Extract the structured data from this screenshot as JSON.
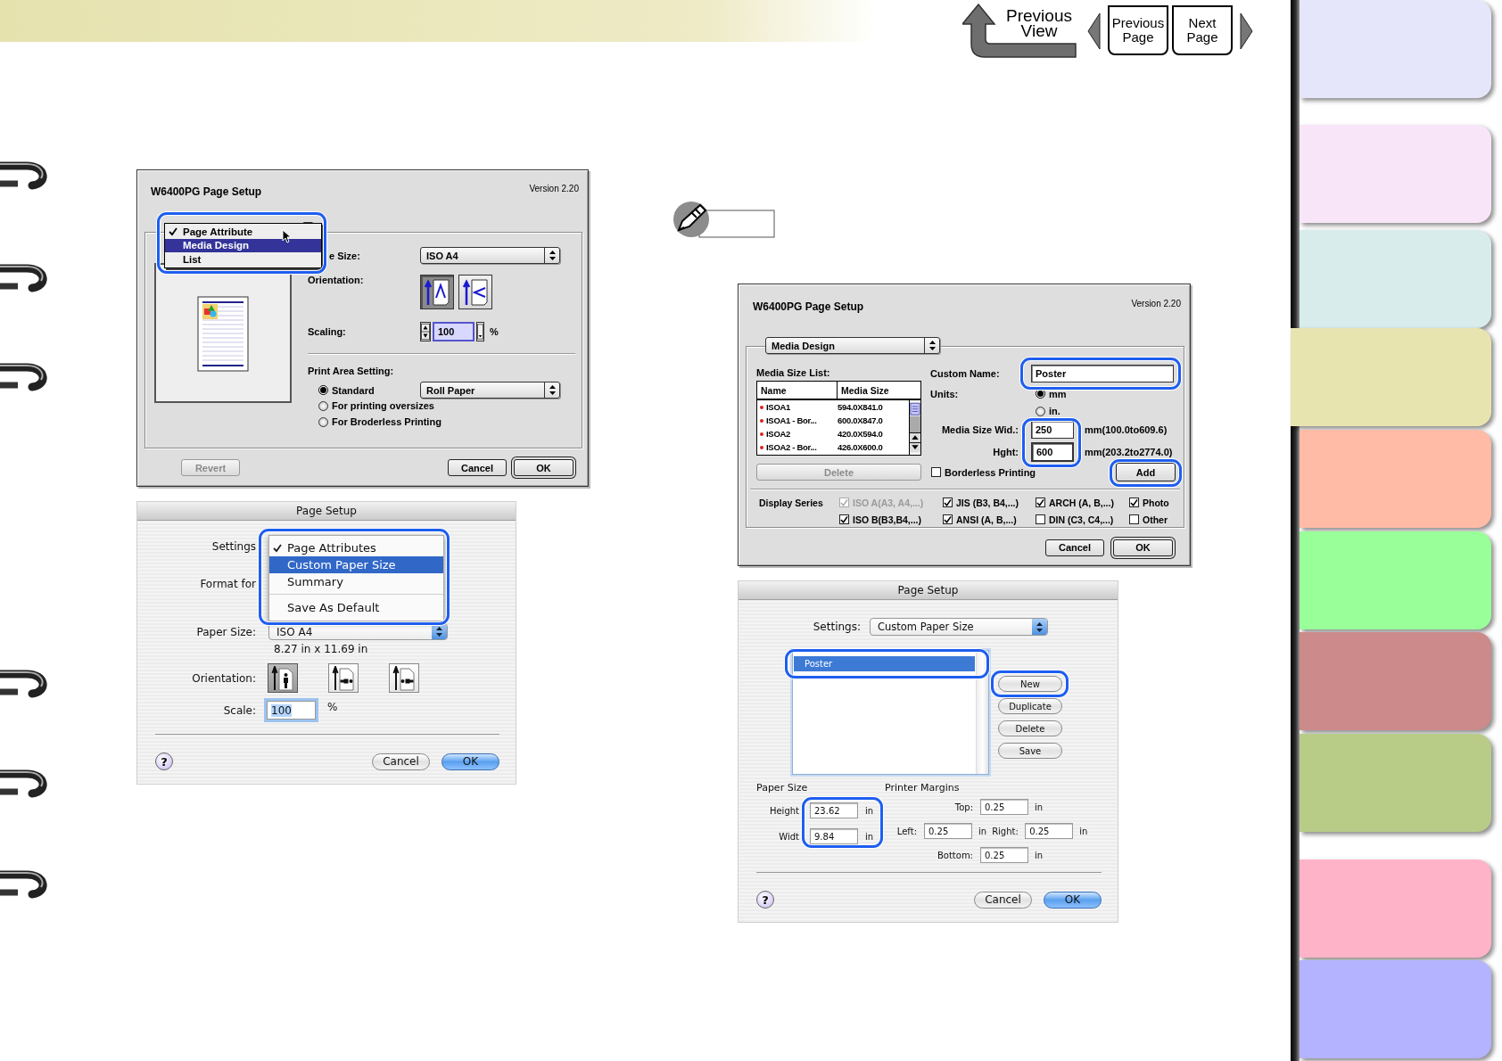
{
  "top_nav": {
    "previous_view": "Previous View",
    "previous_page": "Previous Page",
    "next_page": "Next Page"
  },
  "side_tabs": [
    {
      "color": "#e6e6fa",
      "selected": false
    },
    {
      "color": "#f8e6f8",
      "selected": false
    },
    {
      "color": "#d8ecec",
      "selected": false
    },
    {
      "color": "#e8e4b0",
      "selected": true
    },
    {
      "color": "#ffbba6",
      "selected": false
    },
    {
      "color": "#99ff99",
      "selected": false
    },
    {
      "color": "#cc8a8a",
      "selected": false
    },
    {
      "color": "#b8cc88",
      "selected": false
    },
    {
      "color": "#ffb3c8",
      "selected": false
    },
    {
      "color": "#b3b3ff",
      "selected": false
    }
  ],
  "page_setup_classic": {
    "title": "W6400PG Page Setup",
    "version": "Version 2.20",
    "panel_menu": {
      "highlighted": true,
      "items": [
        {
          "label": "Page Attribute",
          "checked": true,
          "selected": false
        },
        {
          "label": "Media Design",
          "checked": false,
          "selected": true
        },
        {
          "label": "List",
          "checked": false,
          "selected": false
        }
      ]
    },
    "paper_size": {
      "label": "e Size:",
      "value": "ISO A4"
    },
    "orientation": {
      "label": "Orientation:",
      "options": [
        {
          "selected": true
        },
        {
          "selected": false
        }
      ]
    },
    "scaling": {
      "label": "Scaling:",
      "value": "100",
      "unit": "%"
    },
    "print_area": {
      "label": "Print Area Setting:",
      "paper_source": "Roll Paper",
      "options": [
        {
          "label": "Standard",
          "selected": true
        },
        {
          "label": "For printing oversizes",
          "selected": false
        },
        {
          "label": "For Broderless Printing",
          "selected": false
        }
      ]
    },
    "buttons": [
      {
        "label": "Revert",
        "disabled": true,
        "default": false
      },
      {
        "label": "Cancel",
        "disabled": false,
        "default": false
      },
      {
        "label": "OK",
        "disabled": false,
        "default": true
      }
    ]
  },
  "page_setup_aqua": {
    "title": "Page Setup",
    "settings": {
      "label": "Settings",
      "menu": {
        "highlighted": true,
        "items": [
          {
            "label": "Page Attributes",
            "checked": true,
            "selected": false,
            "separator_before": false
          },
          {
            "label": "Custom Paper Size",
            "checked": false,
            "selected": true,
            "separator_before": false
          },
          {
            "label": "Summary",
            "checked": false,
            "selected": false,
            "separator_before": false
          },
          {
            "label": "Save As Default",
            "checked": false,
            "selected": false,
            "separator_before": true
          }
        ]
      }
    },
    "format_for": {
      "label": "Format for"
    },
    "paper_size": {
      "label": "Paper Size:",
      "value": "ISO A4",
      "dimensions": "8.27 in x 11.69 in"
    },
    "orientation": {
      "label": "Orientation:",
      "options": [
        {
          "selected": true
        },
        {
          "selected": false
        },
        {
          "selected": false
        }
      ]
    },
    "scale": {
      "label": "Scale:",
      "value": "100",
      "unit": "%"
    },
    "help": "?",
    "buttons": [
      {
        "label": "Cancel",
        "default": false
      },
      {
        "label": "OK",
        "default": true
      }
    ]
  },
  "media_design_dialog": {
    "title": "W6400PG Page Setup",
    "version": "Version 2.20",
    "panel": "Media Design",
    "media_size_list": {
      "label": "Media Size List:",
      "columns": [
        "Name",
        "Media Size"
      ],
      "rows": [
        [
          "ISOA1",
          "594.0X841.0"
        ],
        [
          "ISOA1 - Bor...",
          "600.0X847.0"
        ],
        [
          "ISOA2",
          "420.0X594.0"
        ],
        [
          "ISOA2 - Bor...",
          "426.0X600.0"
        ]
      ],
      "delete": {
        "label": "Delete",
        "disabled": true
      }
    },
    "custom_name": {
      "label": "Custom Name:",
      "value": "Poster",
      "highlighted": true
    },
    "units": {
      "label": "Units:",
      "options": [
        {
          "label": "mm",
          "selected": true
        },
        {
          "label": "in.",
          "selected": false
        }
      ]
    },
    "size_fields": {
      "highlighted": true,
      "fields": [
        {
          "label": "Media Size Wid.:",
          "value": "250",
          "range": "mm(100.0to609.6)"
        },
        {
          "label": "Hght:",
          "value": "600",
          "range": "mm(203.2to2774.0)"
        }
      ]
    },
    "borderless": {
      "label": "Borderless Printing",
      "checked": false
    },
    "add": {
      "label": "Add",
      "highlighted": true
    },
    "display_series": {
      "label": "Display Series",
      "options": [
        {
          "label": "ISO A(A3, A4,...)",
          "checked": true,
          "disabled": true
        },
        {
          "label": "JIS (B3, B4,...)",
          "checked": true,
          "disabled": false
        },
        {
          "label": "ARCH (A, B,...)",
          "checked": true,
          "disabled": false
        },
        {
          "label": "Photo",
          "checked": true,
          "disabled": false
        },
        {
          "label": "ISO B(B3,B4,...)",
          "checked": true,
          "disabled": false
        },
        {
          "label": "ANSI (A, B,...)",
          "checked": true,
          "disabled": false
        },
        {
          "label": "DIN (C3, C4,...)",
          "checked": false,
          "disabled": false
        },
        {
          "label": "Other",
          "checked": false,
          "disabled": false
        }
      ]
    },
    "buttons": [
      {
        "label": "Cancel",
        "default": false
      },
      {
        "label": "OK",
        "default": true
      }
    ]
  },
  "custom_paper_dialog": {
    "title": "Page Setup",
    "settings": {
      "label": "Settings:",
      "value": "Custom Paper Size"
    },
    "paper_list": {
      "highlighted": true,
      "items": [
        {
          "label": "Poster",
          "selected": true
        }
      ]
    },
    "list_buttons": [
      {
        "label": "New",
        "highlighted": true
      },
      {
        "label": "Duplicate",
        "highlighted": false
      },
      {
        "label": "Delete",
        "highlighted": false
      },
      {
        "label": "Save",
        "highlighted": false
      }
    ],
    "paper_size": {
      "label": "Paper Size",
      "highlighted": true,
      "fields": [
        {
          "label": "Height",
          "value": "23.62",
          "unit": "in"
        },
        {
          "label": "Widt",
          "value": "9.84",
          "unit": "in"
        }
      ]
    },
    "margins": {
      "label": "Printer Margins",
      "fields": [
        {
          "label": "Top:",
          "value": "0.25",
          "unit": "in"
        },
        {
          "label": "Left:",
          "value": "0.25",
          "unit": "in"
        },
        {
          "label": "Right:",
          "value": "0.25",
          "unit": "in"
        },
        {
          "label": "Bottom:",
          "value": "0.25",
          "unit": "in"
        }
      ]
    },
    "help": "?",
    "buttons": [
      {
        "label": "Cancel",
        "default": false
      },
      {
        "label": "OK",
        "default": true
      }
    ]
  }
}
